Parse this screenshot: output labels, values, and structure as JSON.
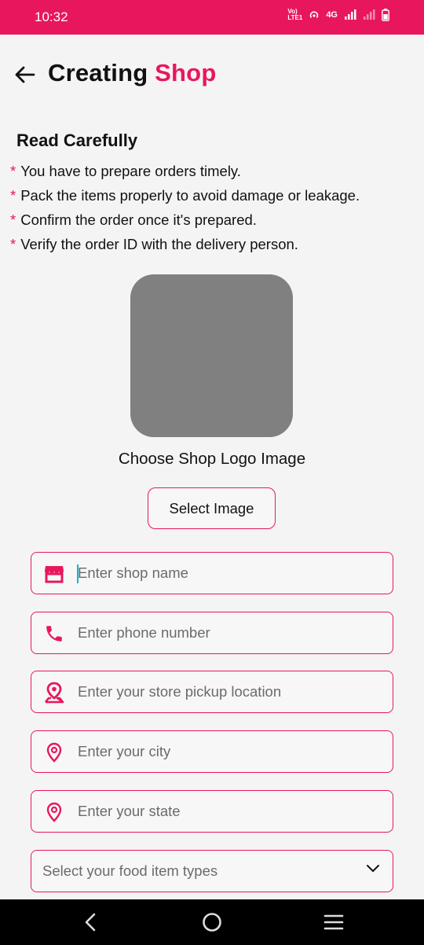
{
  "status_bar": {
    "time": "10:32",
    "network_label": "4G",
    "carrier_label": "Vo))\nLTE1"
  },
  "header": {
    "title_part1": "Creating",
    "title_part2": "Shop"
  },
  "instructions": {
    "heading": "Read Carefully",
    "items": [
      "You have to prepare orders timely.",
      "Pack the items properly to avoid damage or leakage.",
      "Confirm the order once it's prepared.",
      "Verify the order ID with the delivery person."
    ],
    "bullet": "*"
  },
  "logo": {
    "caption": "Choose Shop Logo Image",
    "button_label": "Select Image"
  },
  "form": {
    "shop_name_placeholder": "Enter shop name",
    "phone_placeholder": "Enter phone number",
    "pickup_location_placeholder": "Enter your store pickup location",
    "city_placeholder": "Enter your city",
    "state_placeholder": "Enter your state",
    "food_types_placeholder": "Select your food item types"
  },
  "colors": {
    "accent": "#e8175d",
    "logo_placeholder": "#808080",
    "caret": "#17b6c8"
  },
  "icons": {
    "back": "arrow-left-icon",
    "shop": "storefront-icon",
    "phone": "phone-icon",
    "pickup": "location-pin-icon",
    "city": "map-pin-icon",
    "state": "map-pin-icon",
    "dropdown": "chevron-down-icon"
  }
}
